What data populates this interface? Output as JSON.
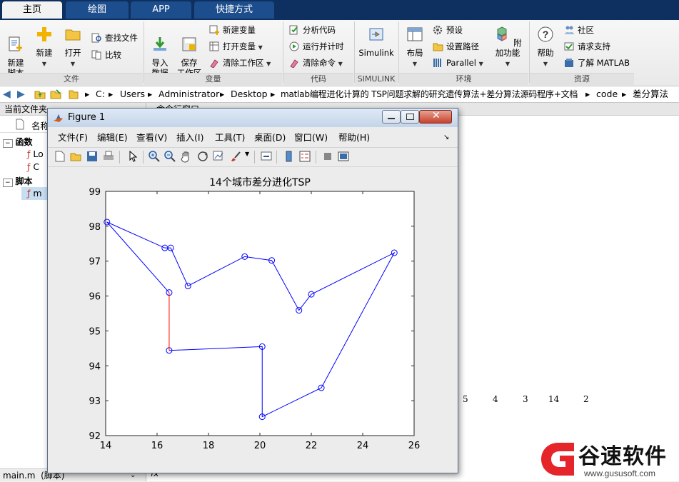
{
  "tabs": [
    {
      "label": "主页",
      "active": true
    },
    {
      "label": "绘图",
      "active": false
    },
    {
      "label": "APP",
      "active": false
    },
    {
      "label": "快捷方式",
      "active": false
    }
  ],
  "ribbon": {
    "file": {
      "group_label": "文件",
      "new_script": "新建\n脚本",
      "new": "新建",
      "open": "打开",
      "find_files": "查找文件",
      "compare": "比较"
    },
    "variable": {
      "group_label": "变量",
      "import": "导入\n数据",
      "save_ws": "保存\n工作区",
      "new_var": "新建变量",
      "open_var": "打开变量",
      "clear_ws": "清除工作区"
    },
    "code": {
      "group_label": "代码",
      "analyze": "分析代码",
      "run_time": "运行并计时",
      "clear_cmds": "清除命令"
    },
    "simulink": {
      "group_label": "SIMULINK",
      "simulink": "Simulink"
    },
    "env": {
      "group_label": "环境",
      "layout": "布局",
      "prefs": "预设",
      "set_path": "设置路径",
      "parallel": "Parallel",
      "addons": "附加功能"
    },
    "resources": {
      "group_label": "资源",
      "help": "帮助",
      "community": "社区",
      "support": "请求支持",
      "learn": "了解 MATLAB"
    }
  },
  "address": {
    "path": [
      "C:",
      "Users",
      "Administrator",
      "Desktop",
      "matlab编程进化计算的 TSP问题求解的研究遗传算法+差分算法源码程序+文档",
      "code",
      "差分算法"
    ]
  },
  "left_panel": {
    "title": "当前文件夹",
    "col_header": "名称",
    "group_functions": "函数",
    "file1": "Lo",
    "file2": "C",
    "group_scripts": "脚本",
    "file3": "m",
    "status": "main.m  (脚本)"
  },
  "command_window": {
    "title": "命令行窗口",
    "output_numbers": [
      "5",
      "4",
      "3",
      "14",
      "2"
    ],
    "prompt": "fx"
  },
  "figure": {
    "title": "Figure 1",
    "menu": [
      "文件(F)",
      "编辑(E)",
      "查看(V)",
      "插入(I)",
      "工具(T)",
      "桌面(D)",
      "窗口(W)",
      "帮助(H)"
    ]
  },
  "chart_data": {
    "type": "line",
    "title": "14个城市差分进化TSP",
    "xlabel": "",
    "ylabel": "",
    "xlim": [
      14,
      26
    ],
    "ylim": [
      92,
      99
    ],
    "xticks": [
      14,
      16,
      18,
      20,
      22,
      24,
      26
    ],
    "yticks": [
      92,
      93,
      94,
      95,
      96,
      97,
      98,
      99
    ],
    "grid": false,
    "series": [
      {
        "color": "#0000ff",
        "marker": "circle",
        "x": [
          16.47,
          14.05,
          16.3,
          16.53,
          17.2,
          19.41,
          20.46,
          21.52,
          22.0,
          25.23,
          22.39,
          20.09,
          20.09,
          16.47
        ],
        "y": [
          96.1,
          98.12,
          97.38,
          97.38,
          96.29,
          97.13,
          97.02,
          95.59,
          96.05,
          97.24,
          93.37,
          92.54,
          94.55,
          94.44
        ]
      },
      {
        "color": "#ff0000",
        "marker": "none",
        "x": [
          16.47,
          16.47
        ],
        "y": [
          94.44,
          96.1
        ]
      }
    ]
  },
  "logo": {
    "name": "谷速软件",
    "url": "www.gususoft.com"
  },
  "colors": {
    "tab_bar": "#0e3060",
    "accent": "#1c4d8c",
    "plot_blue": "#0000ff",
    "plot_red": "#ff0000",
    "logo_red": "#e5252a"
  }
}
